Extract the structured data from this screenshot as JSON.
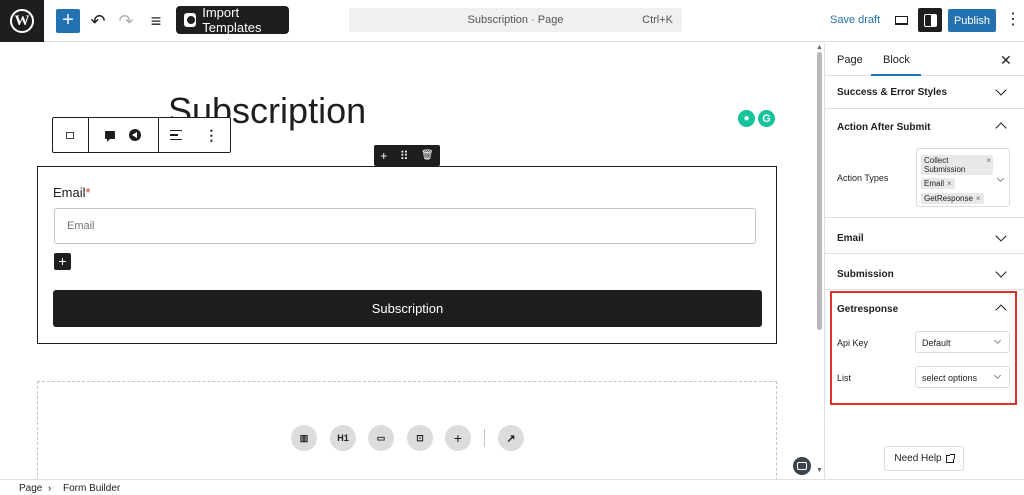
{
  "topbar": {
    "logo_glyph": "W",
    "add_glyph": "+",
    "undo_glyph": "↶",
    "redo_glyph": "↷",
    "list_view_glyph": "≡",
    "import_label": "Import Templates",
    "document_title": "Subscription · Page",
    "shortcut": "Ctrl+K",
    "save_draft_label": "Save draft",
    "publish_label": "Publish",
    "more_glyph": "⋮",
    "accent_color": "#2271b1"
  },
  "canvas": {
    "page_title": "Subscription",
    "block_toolbar": {
      "options_glyph": "⋮"
    },
    "form_toolbar": {
      "add_glyph": "+",
      "drag_glyph": "⠿",
      "delete_glyph": "🗑"
    },
    "form": {
      "email_label": "Email",
      "required_mark": "*",
      "email_placeholder": "Email",
      "add_field_glyph": "+",
      "submit_label": "Subscription"
    },
    "placeholder_buttons": [
      {
        "icon": "columns-icon",
        "glyph": "▥"
      },
      {
        "icon": "heading-icon",
        "glyph": "H1"
      },
      {
        "icon": "input-icon",
        "glyph": "▭"
      },
      {
        "icon": "form-icon",
        "glyph": "⊡"
      },
      {
        "icon": "plus-icon",
        "glyph": "+"
      },
      {
        "icon": "chart-icon",
        "glyph": "↗"
      }
    ]
  },
  "sidebar": {
    "tabs": [
      {
        "label": "Page"
      },
      {
        "label": "Block"
      }
    ],
    "close_glyph": "✕",
    "panels": {
      "success_error": "Success & Error Styles",
      "action_after_submit": "Action After Submit",
      "action_types_label": "Action Types",
      "action_types": [
        "Collect Submission",
        "Email",
        "GetResponse"
      ],
      "tag_remove_glyph": "×",
      "email": "Email",
      "submission": "Submission",
      "getresponse": "Getresponse",
      "api_key_label": "Api Key",
      "api_key_value": "Default",
      "list_label": "List",
      "list_value": "select options"
    },
    "need_help_label": "Need Help",
    "highlight_color": "#e0312a"
  },
  "footer": {
    "breadcrumb": [
      "Page",
      "Form Builder"
    ],
    "separator": "›"
  }
}
